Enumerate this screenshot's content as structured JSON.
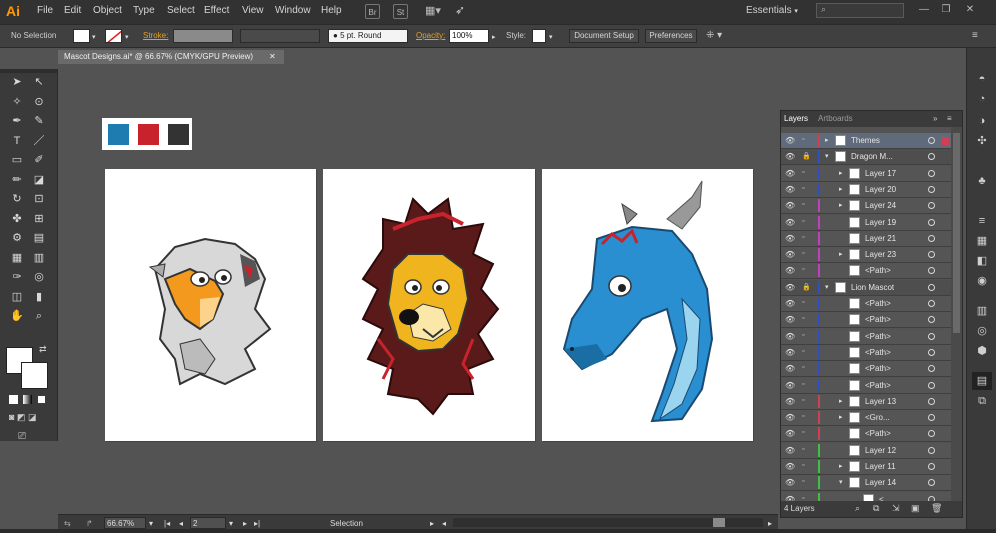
{
  "app": {
    "logo": "Ai",
    "workspace": "Essentials",
    "bridge_label": "Br",
    "stock_label": "St"
  },
  "menu": [
    "File",
    "Edit",
    "Object",
    "Type",
    "Select",
    "Effect",
    "View",
    "Window",
    "Help"
  ],
  "control_bar": {
    "selection_label": "No Selection",
    "stroke_label": "Stroke:",
    "brush_label": "5 pt. Round",
    "opacity_label": "Opacity:",
    "opacity_value": "100%",
    "style_label": "Style:",
    "document_setup": "Document Setup",
    "preferences": "Preferences"
  },
  "document": {
    "tab_title": "Mascot Designs.ai* @ 66.67% (CMYK/GPU Preview)"
  },
  "swatches": [
    "#1f7cb0",
    "#c8232c",
    "#333333"
  ],
  "artboards": [
    "Eagle mascot",
    "Lion mascot",
    "Dragon mascot"
  ],
  "status_bar": {
    "zoom": "66.67%",
    "artboard": "2",
    "tool": "Selection"
  },
  "layers_panel": {
    "tabs": [
      "Layers",
      "Artboards"
    ],
    "footer": "4 Layers",
    "rows": [
      {
        "name": "Themes",
        "indent": 0,
        "expand": "right",
        "color": "#d04050",
        "lock": false,
        "selected": true
      },
      {
        "name": "Dragon M...",
        "indent": 0,
        "expand": "down",
        "color": "#3050c0",
        "lock": true,
        "selected": false
      },
      {
        "name": "Layer 17",
        "indent": 1,
        "expand": "right",
        "color": "#3050c0",
        "lock": false,
        "selected": false
      },
      {
        "name": "Layer 20",
        "indent": 1,
        "expand": "right",
        "color": "#3050c0",
        "lock": false,
        "selected": false
      },
      {
        "name": "Layer 24",
        "indent": 1,
        "expand": "right",
        "color": "#c040c0",
        "lock": false,
        "selected": false
      },
      {
        "name": "Layer 19",
        "indent": 1,
        "expand": "",
        "color": "#c040c0",
        "lock": false,
        "selected": false
      },
      {
        "name": "Layer 21",
        "indent": 1,
        "expand": "",
        "color": "#c040c0",
        "lock": false,
        "selected": false
      },
      {
        "name": "Layer 23",
        "indent": 1,
        "expand": "right",
        "color": "#c040c0",
        "lock": false,
        "selected": false
      },
      {
        "name": "<Path>",
        "indent": 1,
        "expand": "",
        "color": "#c040c0",
        "lock": false,
        "selected": false
      },
      {
        "name": "Lion Mascot",
        "indent": 0,
        "expand": "down",
        "color": "#3050c0",
        "lock": true,
        "selected": false
      },
      {
        "name": "<Path>",
        "indent": 1,
        "expand": "",
        "color": "#3050c0",
        "lock": false,
        "selected": false
      },
      {
        "name": "<Path>",
        "indent": 1,
        "expand": "",
        "color": "#3050c0",
        "lock": false,
        "selected": false
      },
      {
        "name": "<Path>",
        "indent": 1,
        "expand": "",
        "color": "#3050c0",
        "lock": false,
        "selected": false
      },
      {
        "name": "<Path>",
        "indent": 1,
        "expand": "",
        "color": "#3050c0",
        "lock": false,
        "selected": false
      },
      {
        "name": "<Path>",
        "indent": 1,
        "expand": "",
        "color": "#3050c0",
        "lock": false,
        "selected": false
      },
      {
        "name": "<Path>",
        "indent": 1,
        "expand": "",
        "color": "#3050c0",
        "lock": false,
        "selected": false
      },
      {
        "name": "Layer 13",
        "indent": 1,
        "expand": "right",
        "color": "#d04050",
        "lock": false,
        "selected": false
      },
      {
        "name": "<Gro...",
        "indent": 1,
        "expand": "right",
        "color": "#d04050",
        "lock": false,
        "selected": false
      },
      {
        "name": "<Path>",
        "indent": 1,
        "expand": "",
        "color": "#d04050",
        "lock": false,
        "selected": false
      },
      {
        "name": "Layer 12",
        "indent": 1,
        "expand": "",
        "color": "#40c040",
        "lock": false,
        "selected": false
      },
      {
        "name": "Layer 11",
        "indent": 1,
        "expand": "right",
        "color": "#40c040",
        "lock": false,
        "selected": false
      },
      {
        "name": "Layer 14",
        "indent": 1,
        "expand": "down",
        "color": "#40c040",
        "lock": false,
        "selected": false
      },
      {
        "name": "<...",
        "indent": 2,
        "expand": "",
        "color": "#40c040",
        "lock": false,
        "selected": false
      }
    ]
  }
}
